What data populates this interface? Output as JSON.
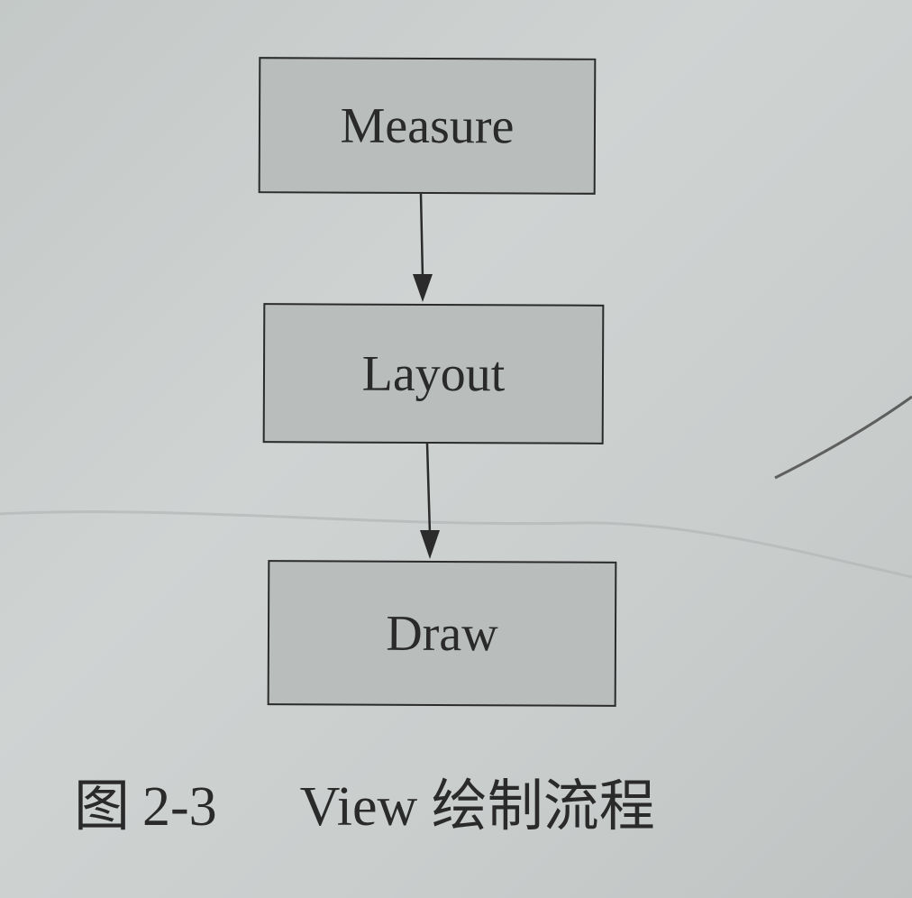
{
  "diagram": {
    "nodes": [
      {
        "id": "measure",
        "label": "Measure"
      },
      {
        "id": "layout",
        "label": "Layout"
      },
      {
        "id": "draw",
        "label": "Draw"
      }
    ],
    "edges": [
      {
        "from": "measure",
        "to": "layout"
      },
      {
        "from": "layout",
        "to": "draw"
      }
    ],
    "colors": {
      "node_fill": "#b9bebd",
      "node_border": "#2b2b2b",
      "text": "#2a2a2a",
      "background": "#cbcfce"
    }
  },
  "caption": {
    "label": "图",
    "number": "2-3",
    "title": "View 绘制流程"
  }
}
